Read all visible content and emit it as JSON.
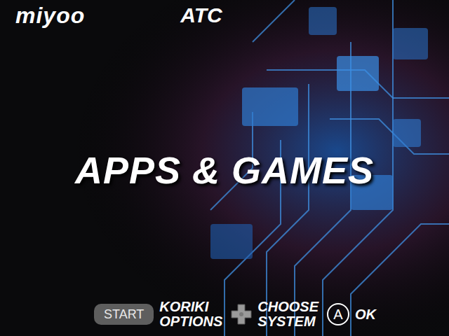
{
  "header": {
    "logo": "miyoo",
    "badge": "ATC"
  },
  "title": "APPS & GAMES",
  "hints": [
    {
      "kind": "pill",
      "key": "START",
      "label": [
        "KORIKI",
        "OPTIONS"
      ]
    },
    {
      "kind": "dpad",
      "label": [
        "CHOOSE",
        "SYSTEM"
      ]
    },
    {
      "kind": "circle",
      "key": "A",
      "label": [
        "OK"
      ]
    }
  ]
}
